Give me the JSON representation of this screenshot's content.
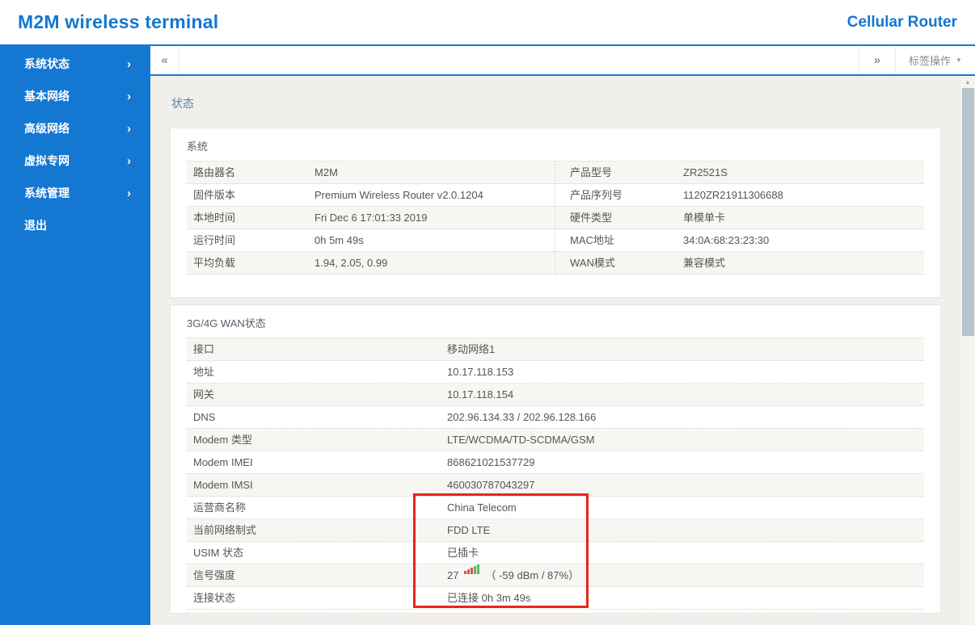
{
  "header": {
    "title": "M2M wireless terminal",
    "product": "Cellular Router"
  },
  "sidebar": {
    "chevron_icon": "›",
    "items": [
      {
        "label": "系统状态"
      },
      {
        "label": "基本网络"
      },
      {
        "label": "高级网络"
      },
      {
        "label": "虚拟专网"
      },
      {
        "label": "系统管理"
      },
      {
        "label": "退出"
      }
    ]
  },
  "tabbar": {
    "scroll_left_icon": "«",
    "scroll_right_icon": "»",
    "menu_label": "标签操作",
    "menu_caret": "▼"
  },
  "page_title": "状态",
  "system": {
    "title": "系统",
    "left_rows": [
      {
        "label": "路由器名",
        "value": "M2M"
      },
      {
        "label": "固件版本",
        "value": "Premium Wireless Router v2.0.1204"
      },
      {
        "label": "本地时间",
        "value": "Fri Dec 6 17:01:33 2019"
      },
      {
        "label": "运行时间",
        "value": "0h 5m 49s"
      },
      {
        "label": "平均负载",
        "value": "1.94, 2.05, 0.99"
      }
    ],
    "right_rows": [
      {
        "label": "产品型号",
        "value": "ZR2521S"
      },
      {
        "label": "产品序列号",
        "value": "1120ZR21911306688"
      },
      {
        "label": "硬件类型",
        "value": "单模单卡"
      },
      {
        "label": "MAC地址",
        "value": "34:0A:68:23:23:30"
      },
      {
        "label": "WAN模式",
        "value": "兼容模式"
      }
    ]
  },
  "wan": {
    "title": "3G/4G WAN状态",
    "rows": [
      {
        "label": "接口",
        "value": "移动网络1"
      },
      {
        "label": "地址",
        "value": "10.17.118.153"
      },
      {
        "label": "网关",
        "value": "10.17.118.154"
      },
      {
        "label": "DNS",
        "value": "202.96.134.33 / 202.96.128.166"
      },
      {
        "label": "Modem 类型",
        "value": "LTE/WCDMA/TD-SCDMA/GSM"
      },
      {
        "label": "Modem IMEI",
        "value": "868621021537729"
      },
      {
        "label": "Modem IMSI",
        "value": "460030787043297"
      },
      {
        "label": "运营商名称",
        "value": "China Telecom"
      },
      {
        "label": "当前网络制式",
        "value": "FDD LTE"
      },
      {
        "label": "USIM 状态",
        "value": "已插卡"
      },
      {
        "label": "信号强度",
        "value": "27",
        "detail": "（ -59 dBm / 87%）"
      },
      {
        "label": "连接状态",
        "value": "已连接 0h 3m 49s"
      }
    ],
    "signal": {
      "bars_total": 5,
      "bars_red": 3,
      "bars_green": 2,
      "csq": "27",
      "dbm": "-59 dBm",
      "percent": "87%"
    }
  },
  "scrollbar": {
    "up_icon": "▲"
  },
  "colors": {
    "brand": "#1377d1",
    "sidebar": "#1478d2",
    "highlight_box": "#e8261a",
    "bar_red": "#d9534f",
    "bar_green": "#5cb85c"
  }
}
